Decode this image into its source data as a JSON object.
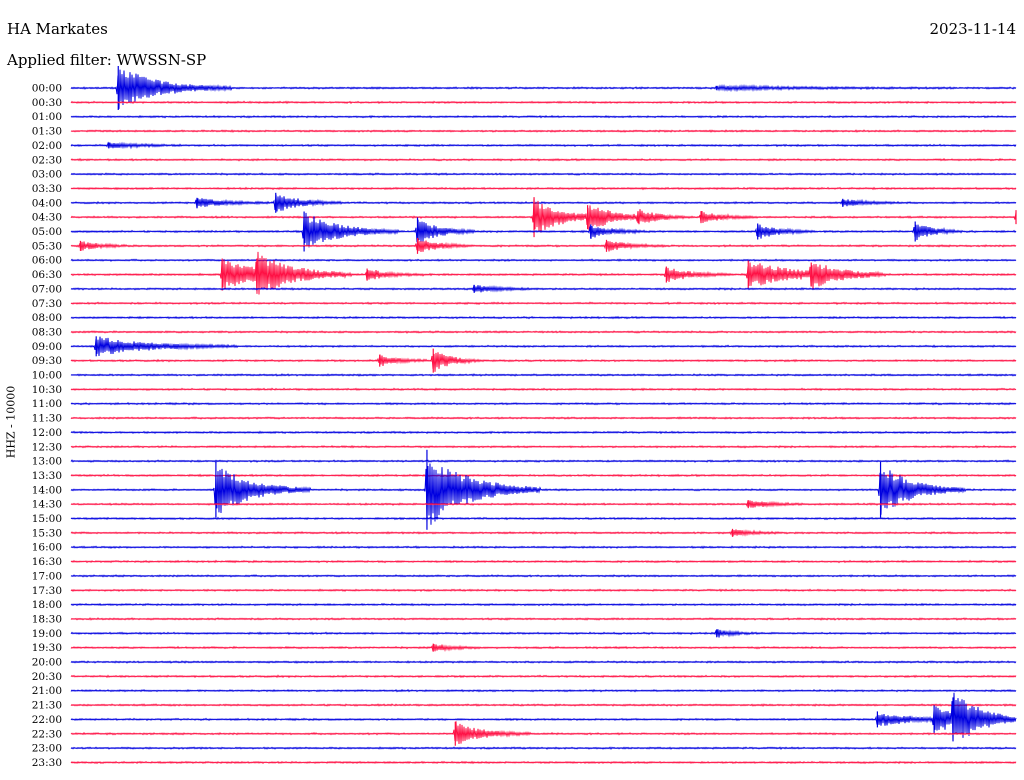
{
  "header": {
    "station": "HA Markates",
    "date": "2023-11-14",
    "filter": "Applied filter: WWSSN-SP"
  },
  "colors": {
    "blue": "#0000e0",
    "red": "#ff1044"
  },
  "chart_data": {
    "type": "helicorder",
    "ylabel": "HHZ - 10000",
    "row_labels": [
      "00:00",
      "00:30",
      "01:00",
      "01:30",
      "02:00",
      "02:30",
      "03:00",
      "03:30",
      "04:00",
      "04:30",
      "05:00",
      "05:30",
      "06:00",
      "06:30",
      "07:00",
      "07:30",
      "08:00",
      "08:30",
      "09:00",
      "09:30",
      "10:00",
      "10:30",
      "11:00",
      "11:30",
      "12:00",
      "12:30",
      "13:00",
      "13:30",
      "14:00",
      "14:30",
      "15:00",
      "15:30",
      "16:00",
      "16:30",
      "17:00",
      "17:30",
      "18:00",
      "18:30",
      "19:00",
      "19:30",
      "20:00",
      "20:30",
      "21:00",
      "21:30",
      "22:00",
      "22:30",
      "23:00",
      "23:30"
    ],
    "row_minutes": 30,
    "row_colors": [
      "blue",
      "red"
    ],
    "events": [
      {
        "row": 0,
        "minute": 1.5,
        "amp": 22,
        "dur": 1.2
      },
      {
        "row": 0,
        "minute": 20.5,
        "amp": 2,
        "dur": 2.5
      },
      {
        "row": 4,
        "minute": 1.2,
        "amp": 3,
        "dur": 0.8
      },
      {
        "row": 8,
        "minute": 4.0,
        "amp": 5,
        "dur": 0.8
      },
      {
        "row": 8,
        "minute": 6.5,
        "amp": 10,
        "dur": 0.7
      },
      {
        "row": 8,
        "minute": 24.5,
        "amp": 4,
        "dur": 0.6
      },
      {
        "row": 9,
        "minute": 14.7,
        "amp": 20,
        "dur": 0.8
      },
      {
        "row": 9,
        "minute": 16.4,
        "amp": 12,
        "dur": 0.9
      },
      {
        "row": 9,
        "minute": 18.0,
        "amp": 6,
        "dur": 0.6
      },
      {
        "row": 9,
        "minute": 20.0,
        "amp": 6,
        "dur": 0.6
      },
      {
        "row": 9,
        "minute": 30.0,
        "amp": 7,
        "dur": 0.5
      },
      {
        "row": 10,
        "minute": 7.4,
        "amp": 20,
        "dur": 1.0
      },
      {
        "row": 10,
        "minute": 11.0,
        "amp": 14,
        "dur": 0.6
      },
      {
        "row": 10,
        "minute": 16.5,
        "amp": 7,
        "dur": 0.6
      },
      {
        "row": 10,
        "minute": 21.8,
        "amp": 8,
        "dur": 0.6
      },
      {
        "row": 10,
        "minute": 26.8,
        "amp": 10,
        "dur": 0.5
      },
      {
        "row": 11,
        "minute": 0.3,
        "amp": 5,
        "dur": 0.5
      },
      {
        "row": 11,
        "minute": 11.0,
        "amp": 8,
        "dur": 0.6
      },
      {
        "row": 11,
        "minute": 17.0,
        "amp": 6,
        "dur": 0.6
      },
      {
        "row": 13,
        "minute": 4.8,
        "amp": 16,
        "dur": 1.3
      },
      {
        "row": 13,
        "minute": 5.9,
        "amp": 16,
        "dur": 1.0
      },
      {
        "row": 13,
        "minute": 9.4,
        "amp": 6,
        "dur": 0.6
      },
      {
        "row": 13,
        "minute": 18.9,
        "amp": 8,
        "dur": 0.7
      },
      {
        "row": 13,
        "minute": 21.5,
        "amp": 14,
        "dur": 1.4
      },
      {
        "row": 13,
        "minute": 23.5,
        "amp": 12,
        "dur": 0.8
      },
      {
        "row": 14,
        "minute": 12.8,
        "amp": 4,
        "dur": 0.7
      },
      {
        "row": 18,
        "minute": 0.8,
        "amp": 10,
        "dur": 1.5
      },
      {
        "row": 19,
        "minute": 9.8,
        "amp": 6,
        "dur": 0.5
      },
      {
        "row": 19,
        "minute": 11.5,
        "amp": 12,
        "dur": 0.5
      },
      {
        "row": 28,
        "minute": 4.6,
        "amp": 28,
        "dur": 1.0
      },
      {
        "row": 28,
        "minute": 11.3,
        "amp": 40,
        "dur": 1.2
      },
      {
        "row": 28,
        "minute": 25.7,
        "amp": 28,
        "dur": 0.9
      },
      {
        "row": 29,
        "minute": 21.5,
        "amp": 4,
        "dur": 0.6
      },
      {
        "row": 31,
        "minute": 21.0,
        "amp": 4,
        "dur": 0.5
      },
      {
        "row": 38,
        "minute": 20.5,
        "amp": 4,
        "dur": 0.4
      },
      {
        "row": 39,
        "minute": 11.5,
        "amp": 4,
        "dur": 0.5
      },
      {
        "row": 44,
        "minute": 25.6,
        "amp": 8,
        "dur": 0.9
      },
      {
        "row": 44,
        "minute": 27.4,
        "amp": 14,
        "dur": 0.8
      },
      {
        "row": 44,
        "minute": 28.0,
        "amp": 22,
        "dur": 0.9
      },
      {
        "row": 45,
        "minute": 12.2,
        "amp": 12,
        "dur": 0.8
      }
    ]
  }
}
